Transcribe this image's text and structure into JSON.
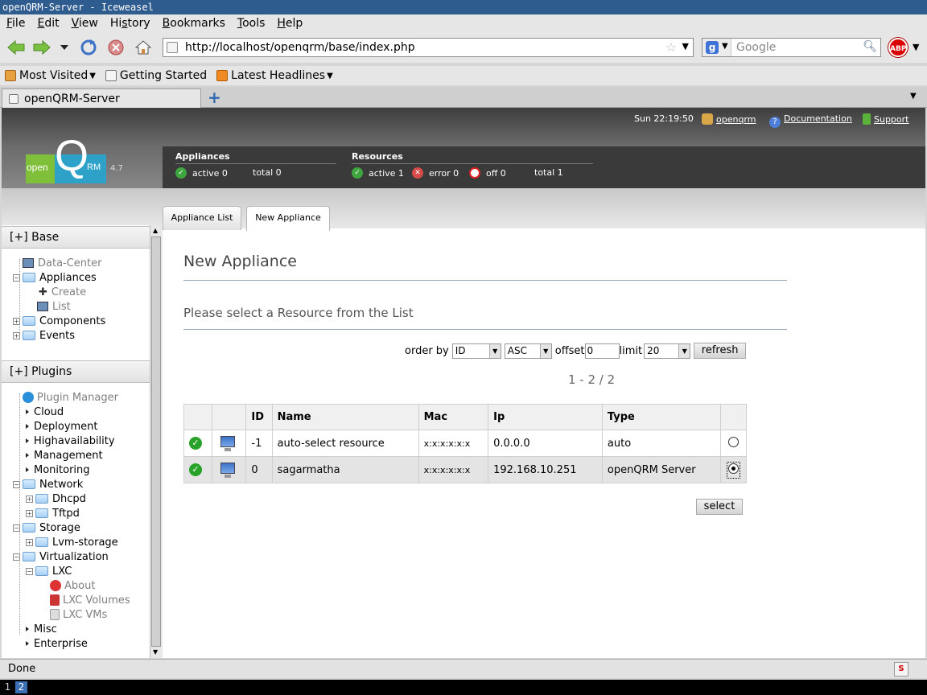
{
  "window": {
    "title": "openQRM-Server - Iceweasel"
  },
  "menu": [
    "File",
    "Edit",
    "View",
    "History",
    "Bookmarks",
    "Tools",
    "Help"
  ],
  "menu_underline": [
    "F",
    "E",
    "V",
    "s",
    "B",
    "T",
    "H"
  ],
  "toolbar": {
    "url": "http://localhost/openqrm/base/index.php",
    "search_placeholder": "Google",
    "abp_label": "ABP"
  },
  "bookmarks": [
    {
      "label": "Most Visited",
      "dropdown": true
    },
    {
      "label": "Getting Started",
      "dropdown": false
    },
    {
      "label": "Latest Headlines",
      "dropdown": true
    }
  ],
  "browser_tab": {
    "label": "openQRM-Server"
  },
  "header": {
    "time": "Sun 22:19:50",
    "user": "openqrm",
    "documentation": "Documentation",
    "support": "Support",
    "logo_open": "open",
    "logo_q": "Q",
    "logo_rm": "RM",
    "version": "4.7"
  },
  "stats": {
    "appliances": {
      "title": "Appliances",
      "active": "active 0",
      "total": "total 0"
    },
    "resources": {
      "title": "Resources",
      "active": "active 1",
      "error": "error 0",
      "off": "off 0",
      "total": "total 1"
    }
  },
  "tabs": {
    "list": "Appliance List",
    "new": "New Appliance"
  },
  "sidebar": {
    "base_header": "[+] Base",
    "plugins_header": "[+] Plugins",
    "base_items": {
      "datacenter": "Data-Center",
      "appliances": "Appliances",
      "create": "Create",
      "list": "List",
      "components": "Components",
      "events": "Events"
    },
    "plugin_items": {
      "plugin_manager": "Plugin Manager",
      "cloud": "Cloud",
      "deployment": "Deployment",
      "highavailability": "Highavailability",
      "management": "Management",
      "monitoring": "Monitoring",
      "network": "Network",
      "dhcpd": "Dhcpd",
      "tftpd": "Tftpd",
      "storage": "Storage",
      "lvm_storage": "Lvm-storage",
      "virtualization": "Virtualization",
      "lxc": "LXC",
      "about": "About",
      "lxc_volumes": "LXC Volumes",
      "lxc_vms": "LXC VMs",
      "misc": "Misc",
      "enterprise": "Enterprise"
    }
  },
  "main": {
    "title": "New Appliance",
    "subtitle": "Please select a Resource from the List",
    "order_by_label": "order by",
    "order_by_value": "ID",
    "sort_value": "ASC",
    "offset_label": "offset",
    "offset_value": "0",
    "limit_label": "limit",
    "limit_value": "20",
    "refresh": "refresh",
    "pager": "1 - 2 / 2",
    "select": "select",
    "columns": [
      "",
      "",
      "ID",
      "Name",
      "Mac",
      "Ip",
      "Type",
      ""
    ],
    "rows": [
      {
        "id": "-1",
        "name": "auto-select resource",
        "mac": "x:x:x:x:x:x",
        "ip": "0.0.0.0",
        "type": "auto",
        "selected": false
      },
      {
        "id": "0",
        "name": "sagarmatha",
        "mac": "x:x:x:x:x:x",
        "ip": "192.168.10.251",
        "type": "openQRM Server",
        "selected": true
      }
    ]
  },
  "statusbar": {
    "text": "Done"
  },
  "taskbar": {
    "workspaces": [
      "1",
      "2"
    ],
    "active_workspace": "2"
  },
  "colors": {
    "titlebar": "#2f5c8f",
    "header_dark": "#3a3a3a",
    "ok_green": "#28a228",
    "error_red": "#d64a4a"
  }
}
